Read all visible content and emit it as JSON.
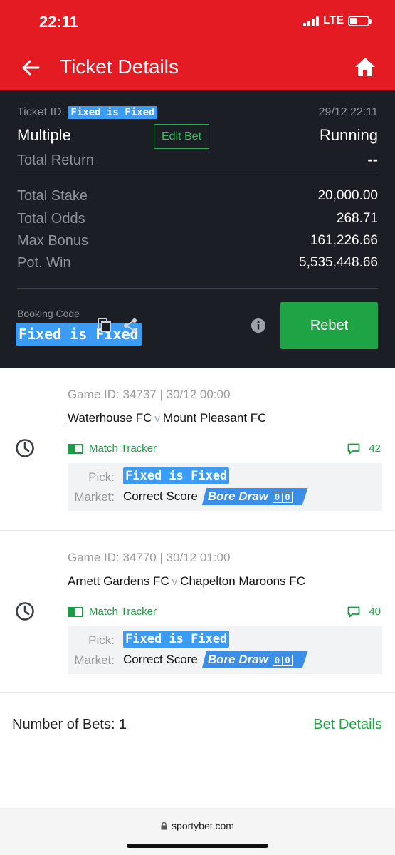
{
  "status_bar": {
    "time": "22:11",
    "network": "LTE"
  },
  "header": {
    "title": "Ticket Details",
    "back_icon": "arrow-left-icon",
    "home_icon": "home-icon"
  },
  "summary": {
    "ticket_id_label": "Ticket ID:",
    "ticket_id_value": "Fixed is Fixed",
    "date": "29/12 22:11",
    "bet_type": "Multiple",
    "edit_bet_label": "Edit Bet",
    "status": "Running",
    "total_return_label": "Total Return",
    "total_return_value": "--",
    "stats": [
      {
        "label": "Total Stake",
        "value": "20,000.00"
      },
      {
        "label": "Total Odds",
        "value": "268.71"
      },
      {
        "label": "Max Bonus",
        "value": "161,226.66"
      },
      {
        "label": "Pot. Win",
        "value": "5,535,448.66"
      }
    ],
    "booking_label": "Booking Code",
    "booking_value": "Fixed is Fixed",
    "rebet_label": "Rebet"
  },
  "selections": [
    {
      "game_id": "Game ID: 34737 | 30/12 00:00",
      "home_team": "Waterhouse FC",
      "vs": "v",
      "away_team": "Mount Pleasant FC",
      "tracker_label": "Match Tracker",
      "comments": "42",
      "pick_label": "Pick:",
      "pick_value": "Fixed is Fixed",
      "market_label": "Market:",
      "market_value": "Correct Score",
      "tag_label": "Bore Draw",
      "tag_score": "0|0"
    },
    {
      "game_id": "Game ID: 34770 | 30/12 01:00",
      "home_team": "Arnett Gardens FC",
      "vs": "v",
      "away_team": "Chapelton Maroons FC",
      "tracker_label": "Match Tracker",
      "comments": "40",
      "pick_label": "Pick:",
      "pick_value": "Fixed is Fixed",
      "market_label": "Market:",
      "market_value": "Correct Score",
      "tag_label": "Bore Draw",
      "tag_score": "0|0"
    }
  ],
  "footer": {
    "num_bets": "Number of Bets: 1",
    "bet_details": "Bet Details"
  },
  "browser": {
    "url": "sportybet.com"
  },
  "colors": {
    "brand_red": "#e41b23",
    "panel_dark": "#1b1e25",
    "accent_green": "#1ea445",
    "tag_blue": "#3a9cf5"
  }
}
